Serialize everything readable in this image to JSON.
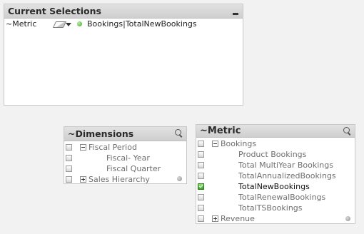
{
  "current_selections": {
    "title": "Current Selections",
    "rows": [
      {
        "field": "~Metric",
        "value": "Bookings|TotalNewBookings"
      }
    ]
  },
  "dimensions": {
    "title": "~Dimensions",
    "items": [
      {
        "label": "Fiscal Period",
        "level": 1,
        "toggle": "minus",
        "selected": false
      },
      {
        "label": "Fiscal- Year",
        "level": 3,
        "toggle": null,
        "selected": false
      },
      {
        "label": "Fiscal Quarter",
        "level": 3,
        "toggle": null,
        "selected": false
      },
      {
        "label": "Sales Hierarchy",
        "level": 1,
        "toggle": "plus",
        "selected": false
      }
    ]
  },
  "metric": {
    "title": "~Metric",
    "items": [
      {
        "label": "Bookings",
        "level": 1,
        "toggle": "minus",
        "selected": false
      },
      {
        "label": "Product Bookings",
        "level": 2,
        "toggle": null,
        "selected": false
      },
      {
        "label": "Total MultiYear Bookings",
        "level": 2,
        "toggle": null,
        "selected": false
      },
      {
        "label": "TotalAnnualizedBookings",
        "level": 2,
        "toggle": null,
        "selected": false
      },
      {
        "label": "TotalNewBookings",
        "level": 2,
        "toggle": null,
        "selected": true
      },
      {
        "label": "TotalRenewalBookings",
        "level": 2,
        "toggle": null,
        "selected": false
      },
      {
        "label": "TotalTSBookings",
        "level": 2,
        "toggle": null,
        "selected": false
      },
      {
        "label": "Revenue",
        "level": 1,
        "toggle": "plus",
        "selected": false
      }
    ]
  },
  "colors": {
    "selected_green": "#3aa61e",
    "caption_bg": "#d6d6d6",
    "excluded_text": "#6e6e6e"
  },
  "icons": [
    "minimize-icon",
    "search-icon",
    "eraser-icon",
    "dropdown-arrow-icon",
    "selection-dot-icon",
    "expand-icon",
    "collapse-icon",
    "scroll-dot-icon"
  ]
}
